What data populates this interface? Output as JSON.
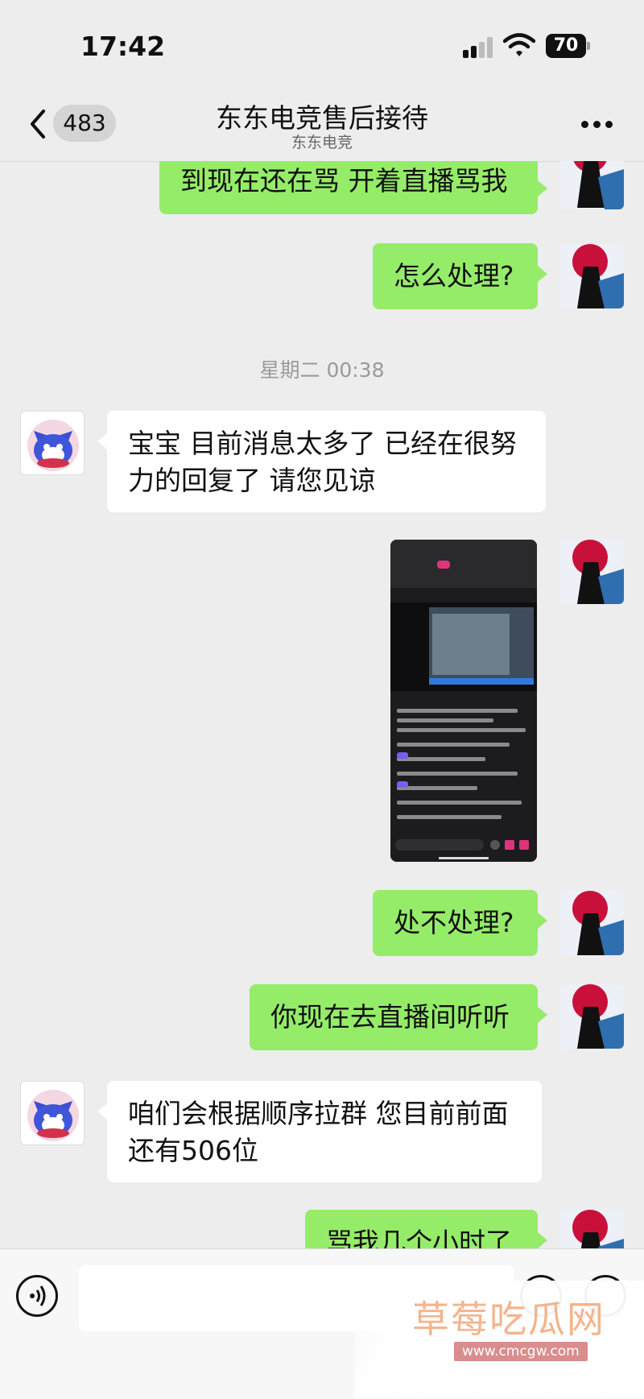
{
  "status_bar": {
    "time": "17:42",
    "battery": "70"
  },
  "nav": {
    "unread_count": "483",
    "title": "东东电竞售后接待",
    "subtitle": "东东电竞"
  },
  "messages": [
    {
      "from": "me",
      "text": "到现在还在骂 开着直播骂我"
    },
    {
      "from": "me",
      "text": "怎么处理?"
    },
    {
      "from": "cs",
      "text_lines": [
        "宝宝 目前消息太多了 已经在很努",
        "力的回复了 请您见谅"
      ]
    },
    {
      "from": "me",
      "type": "image",
      "caption": "screenshot of a live stream"
    },
    {
      "from": "me",
      "text": "处不处理?"
    },
    {
      "from": "me",
      "text": "你现在去直播间听听"
    },
    {
      "from": "cs",
      "text_lines": [
        "咱们会根据顺序拉群 您目前前面",
        "还有506位"
      ]
    },
    {
      "from": "me",
      "text": "骂我几个小时了"
    }
  ],
  "timestamp": "星期二 00:38",
  "watermark": {
    "main": "草莓吃瓜网",
    "sub": "www.cmcgw.com"
  },
  "colors": {
    "background": "#ededed",
    "bubble_me": "#95ec69",
    "bubble_cs": "#ffffff"
  },
  "icons": [
    "back-icon",
    "more-icon",
    "voice-icon",
    "emoji-icon",
    "plus-icon",
    "signal-icon",
    "wifi-icon",
    "battery-icon"
  ]
}
